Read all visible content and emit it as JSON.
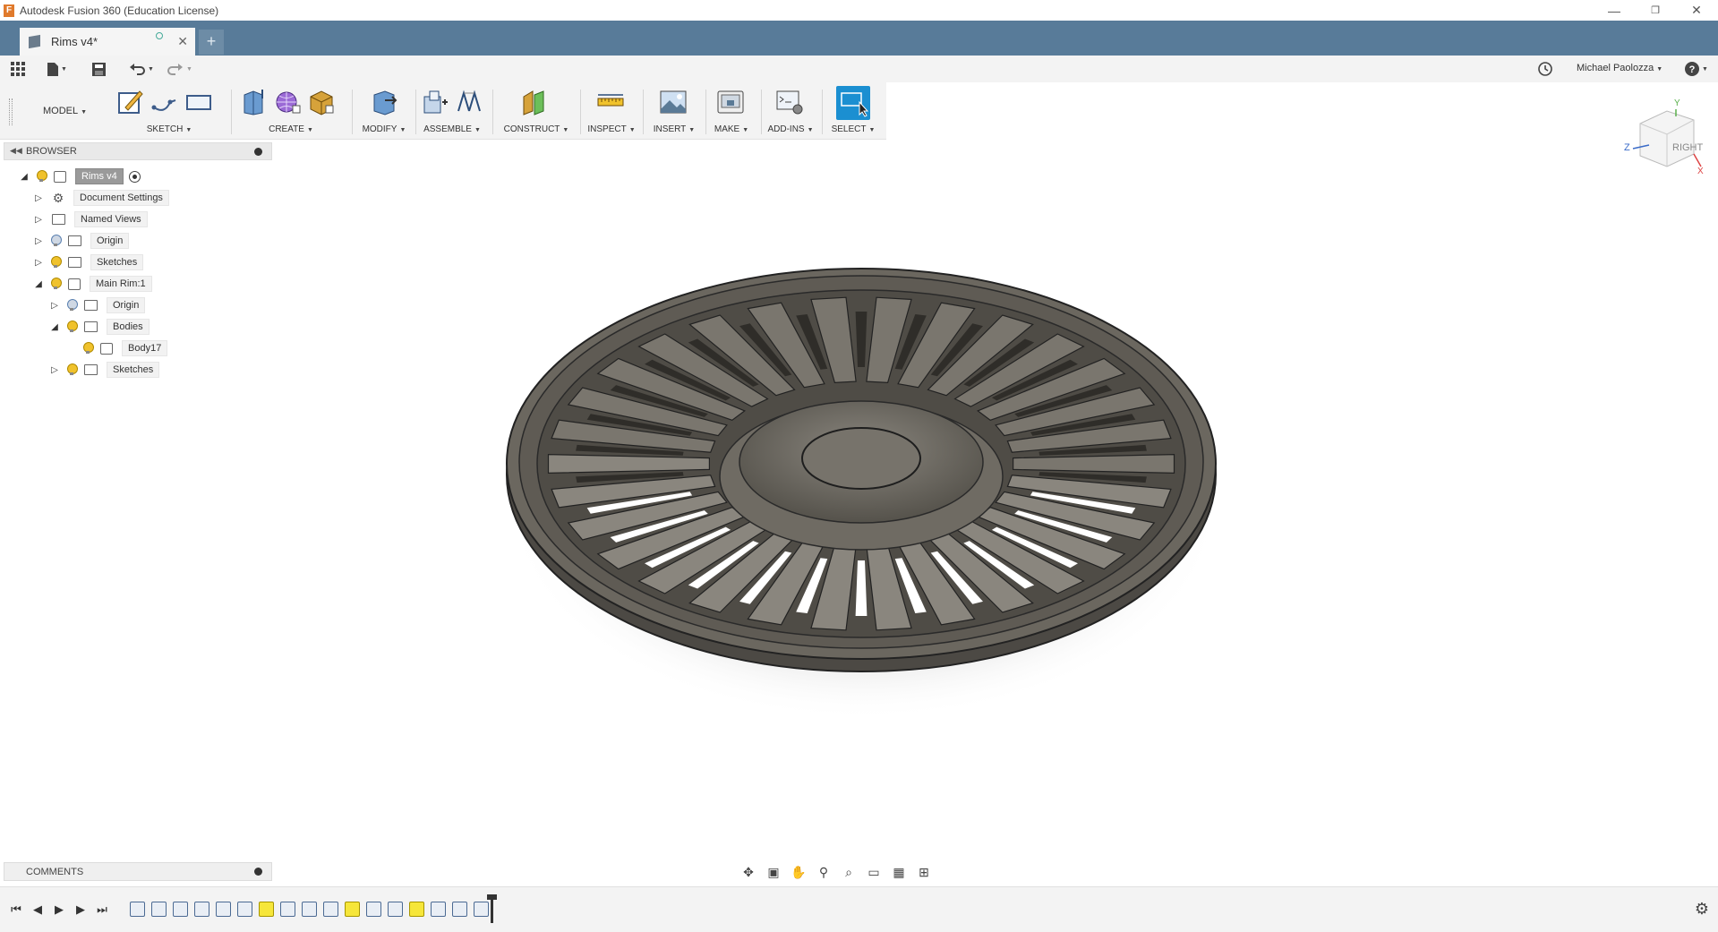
{
  "window": {
    "title": "Autodesk Fusion 360 (Education License)",
    "app_icon_letter": "F",
    "minimize": "—",
    "restore": "❐",
    "close": "✕"
  },
  "tab": {
    "label": "Rims v4*",
    "close": "✕",
    "new": "+"
  },
  "quickbar": {
    "user": "Michael Paolozza"
  },
  "toolbar": {
    "workspace": "MODEL",
    "groups": [
      "SKETCH",
      "CREATE",
      "MODIFY",
      "ASSEMBLE",
      "CONSTRUCT",
      "INSPECT",
      "INSERT",
      "MAKE",
      "ADD-INS",
      "SELECT"
    ]
  },
  "browser": {
    "title": "BROWSER",
    "items": [
      {
        "label": "Rims v4"
      },
      {
        "label": "Document Settings"
      },
      {
        "label": "Named Views"
      },
      {
        "label": "Origin"
      },
      {
        "label": "Sketches"
      },
      {
        "label": "Main Rim:1"
      },
      {
        "label": "Origin"
      },
      {
        "label": "Bodies"
      },
      {
        "label": "Body17"
      },
      {
        "label": "Sketches"
      }
    ]
  },
  "viewcube": {
    "face": "RIGHT",
    "axis_z": "Z",
    "axis_y": "Y",
    "axis_x": "X"
  },
  "comments": {
    "title": "COMMENTS"
  },
  "colors": {
    "tab_bar": "#587b99",
    "select_active": "#1b8fd1",
    "timeline_highlight": "#f6e63a",
    "model_body": "#6b675f"
  },
  "icons": [
    "grid-menu-icon",
    "file-icon",
    "save-icon",
    "undo-icon",
    "redo-icon",
    "clock-icon",
    "help-icon",
    "gear-icon"
  ]
}
